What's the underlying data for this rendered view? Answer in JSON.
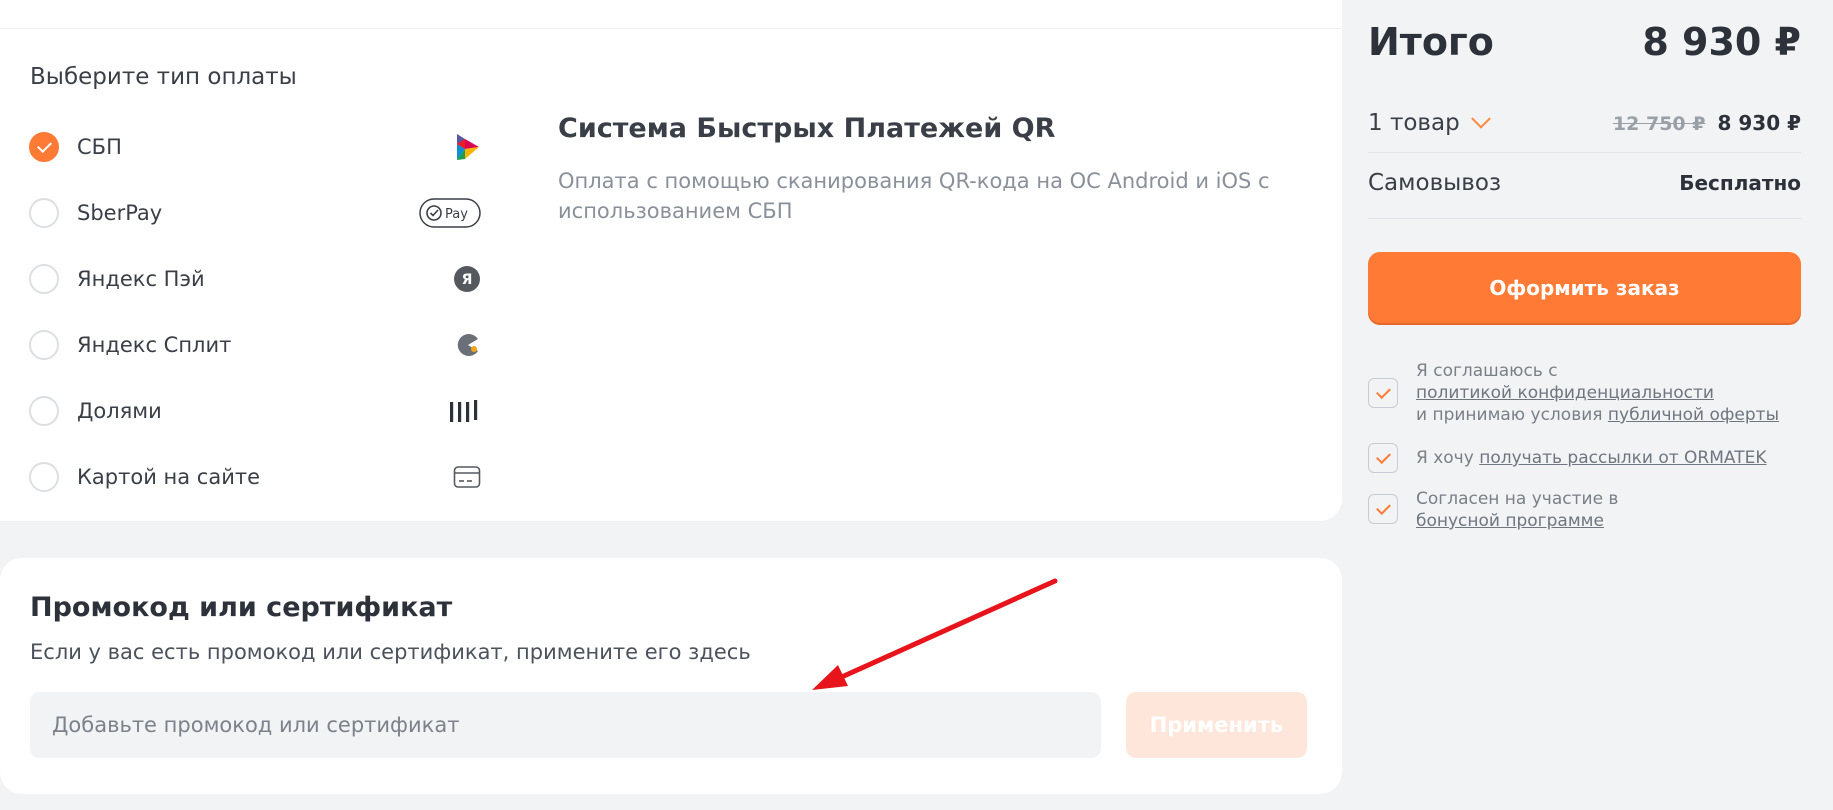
{
  "payment": {
    "title": "Выберите тип оплаты",
    "options": [
      {
        "label": "СБП",
        "selected": true,
        "icon": "sbp-icon"
      },
      {
        "label": "SberPay",
        "selected": false,
        "icon": "sberpay-icon",
        "icon_text": "Pay"
      },
      {
        "label": "Яндекс Пэй",
        "selected": false,
        "icon": "yandex-pay-icon",
        "icon_text": "Я"
      },
      {
        "label": "Яндекс Сплит",
        "selected": false,
        "icon": "yandex-split-icon"
      },
      {
        "label": "Долями",
        "selected": false,
        "icon": "dolyami-icon"
      },
      {
        "label": "Картой на сайте",
        "selected": false,
        "icon": "card-icon"
      }
    ],
    "description_title": "Система Быстрых Платежей QR",
    "description_text": "Оплата с помощью сканирования QR-кода на ОС Android и iOS с использованием СБП"
  },
  "promo": {
    "title": "Промокод или сертификат",
    "subtitle": "Если у вас есть промокод или сертификат, примените его здесь",
    "placeholder": "Добавьте промокод или сертификат",
    "value": "",
    "apply_label": "Применить"
  },
  "summary": {
    "total_label": "Итого",
    "total_value": "8 930 ₽",
    "items_label": "1 товар",
    "old_price": "12 750 ₽",
    "new_price": "8 930 ₽",
    "pickup_label": "Самовывоз",
    "pickup_value": "Бесплатно",
    "order_label": "Оформить заказ"
  },
  "agreements": [
    {
      "checked": true,
      "text1": "Я соглашаюсь с",
      "link1": "политикой конфиденциальности",
      "text2": "и принимаю условия",
      "link2": "публичной оферты"
    },
    {
      "checked": true,
      "text1": "Я хочу",
      "link1": "получать рассылки от ORMATEK"
    },
    {
      "checked": true,
      "text1": "Согласен на участие в",
      "link1": "бонусной программе"
    }
  ],
  "colors": {
    "accent": "#ff7a35",
    "annotation_arrow": "#e8141c"
  }
}
